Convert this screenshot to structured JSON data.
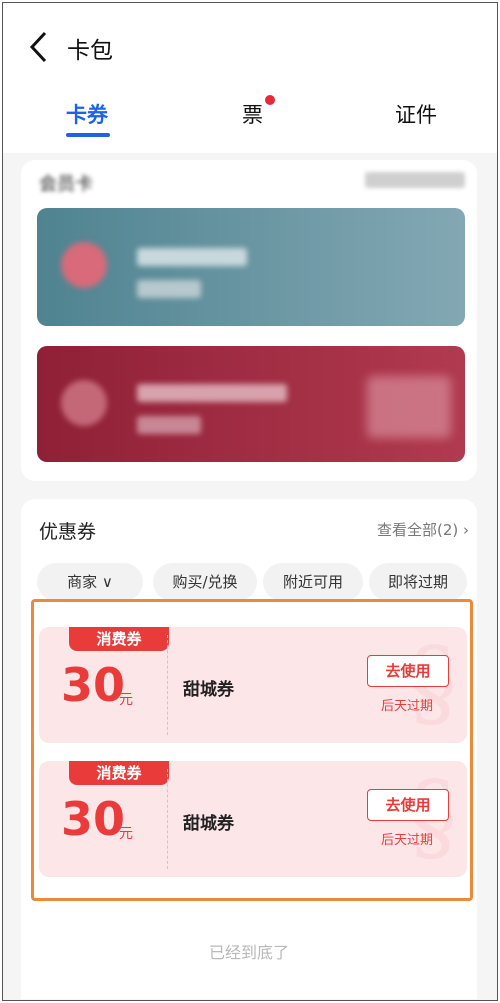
{
  "header": {
    "title": "卡包"
  },
  "tabs": [
    {
      "label": "卡券",
      "active": true
    },
    {
      "label": "票",
      "has_dot": true
    },
    {
      "label": "证件"
    }
  ],
  "colors": {
    "accent": "#1d63e6",
    "coupon_red": "#ea3b3b",
    "highlight": "#ec8a3c"
  },
  "coupons": {
    "title": "优惠券",
    "view_all": "查看全部(2) ›",
    "filters": [
      "商家 ∨",
      "购买/兑换",
      "附近可用",
      "即将过期"
    ],
    "items": [
      {
        "badge": "消费券",
        "amount": "30",
        "unit": "元",
        "name": "甜城券",
        "action": "去使用",
        "expire": "后天过期"
      },
      {
        "badge": "消费券",
        "amount": "30",
        "unit": "元",
        "name": "甜城券",
        "action": "去使用",
        "expire": "后天过期"
      }
    ],
    "end_text": "已经到底了"
  },
  "icons": {
    "back": "chevron-left-icon"
  }
}
